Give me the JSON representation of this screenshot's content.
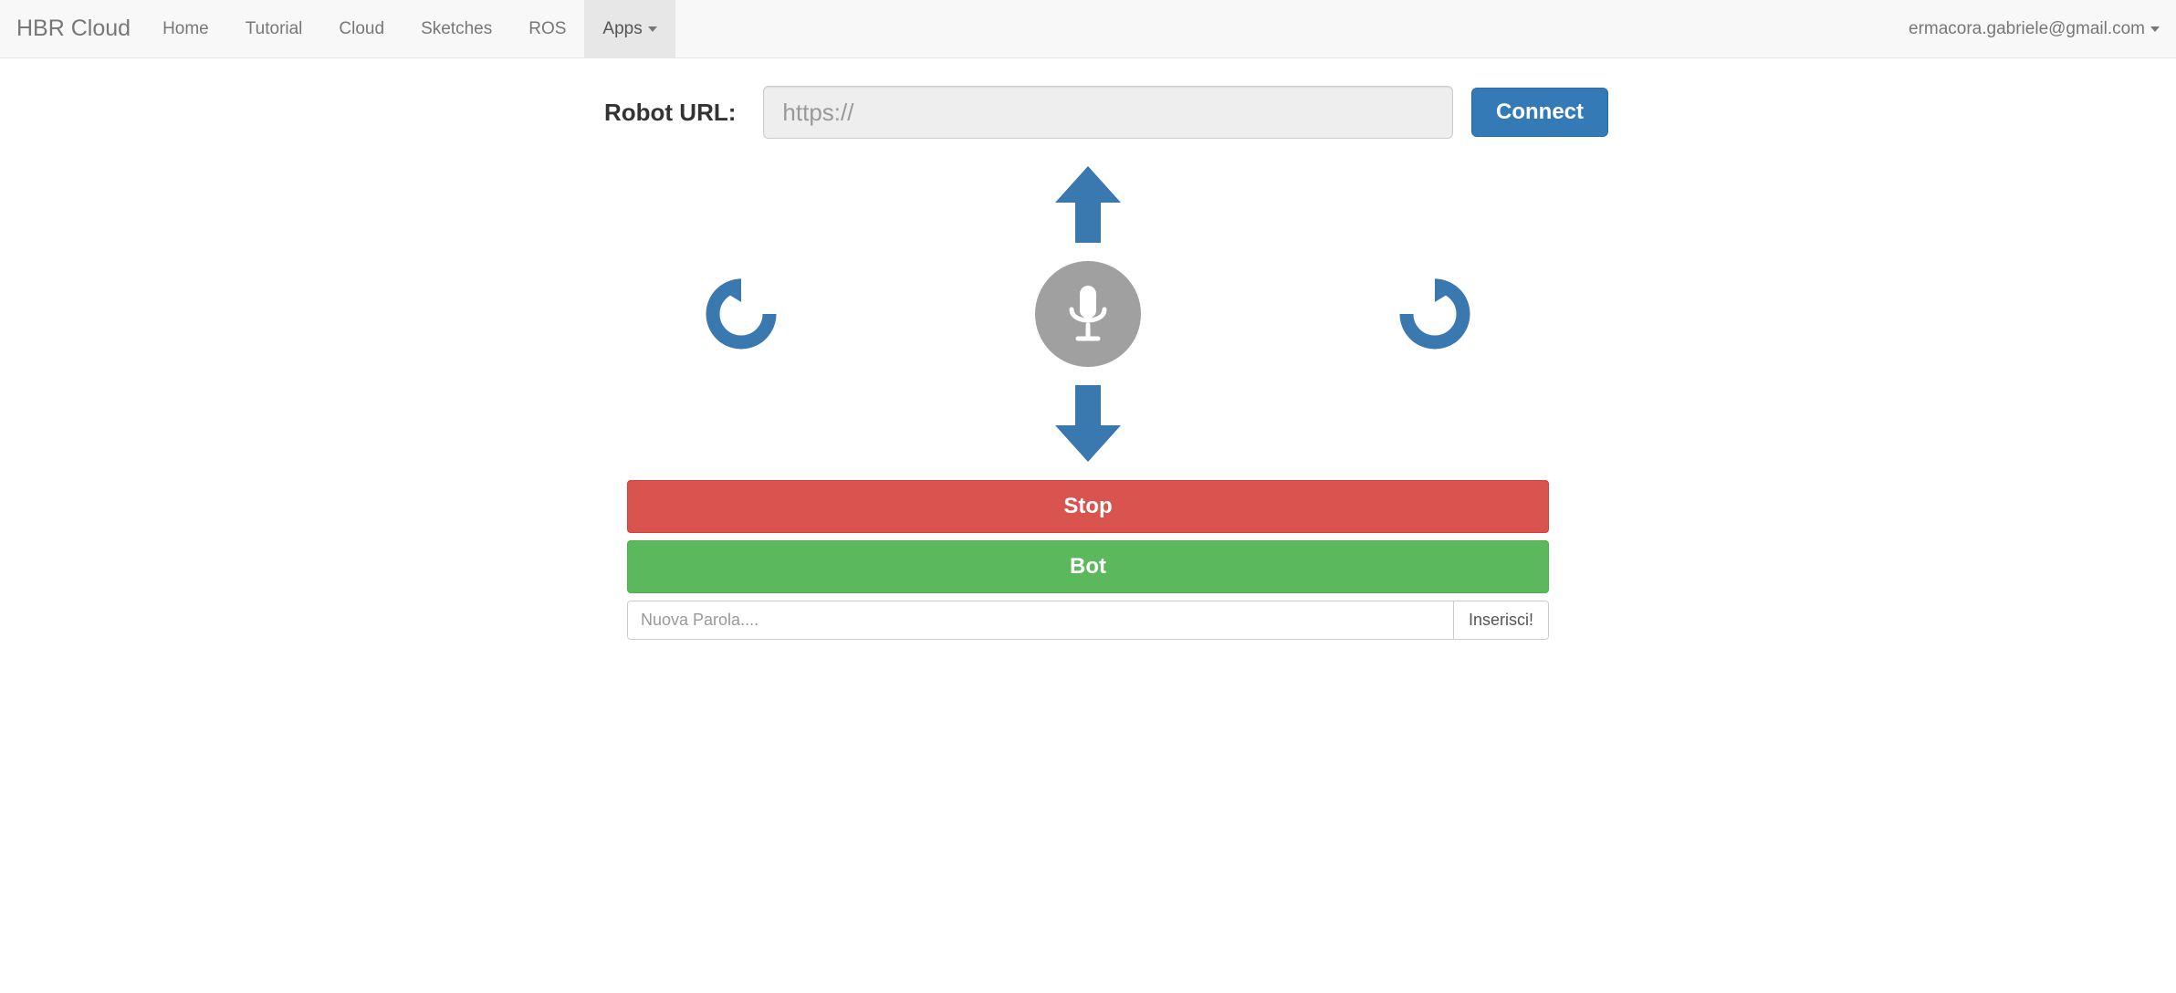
{
  "navbar": {
    "brand": "HBR Cloud",
    "items": [
      {
        "label": "Home",
        "active": false
      },
      {
        "label": "Tutorial",
        "active": false
      },
      {
        "label": "Cloud",
        "active": false
      },
      {
        "label": "Sketches",
        "active": false
      },
      {
        "label": "ROS",
        "active": false
      },
      {
        "label": "Apps",
        "active": true,
        "dropdown": true
      }
    ],
    "user": "ermacora.gabriele@gmail.com"
  },
  "form": {
    "label": "Robot URL:",
    "placeholder": "https://",
    "value": "",
    "connect_label": "Connect"
  },
  "controls": {
    "up_icon": "arrow-up",
    "down_icon": "arrow-down",
    "rotate_left_icon": "rotate-ccw",
    "rotate_right_icon": "rotate-cw",
    "mic_icon": "microphone"
  },
  "actions": {
    "stop_label": "Stop",
    "bot_label": "Bot"
  },
  "word_input": {
    "placeholder": "Nuova Parola....",
    "value": "",
    "button_label": "Inserisci!"
  },
  "colors": {
    "primary": "#337ab7",
    "danger": "#d9534f",
    "success": "#5cb85c",
    "arrow": "#3a78b0",
    "mic_bg": "#a0a0a0"
  }
}
